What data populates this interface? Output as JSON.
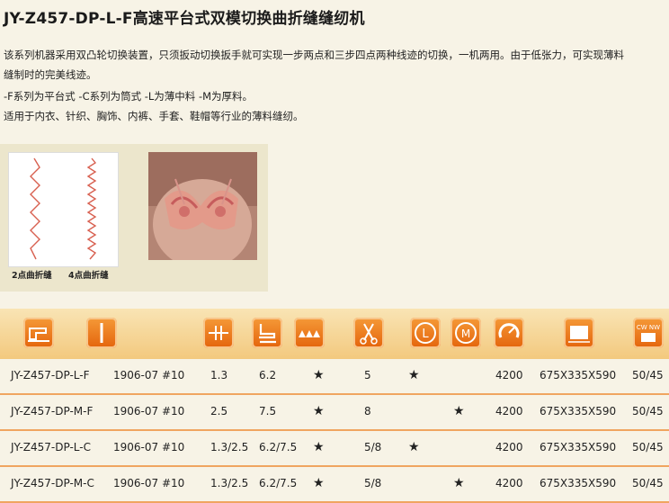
{
  "title": "JY-Z457-DP-L-F高速平台式双模切换曲折缝缝纫机",
  "description": {
    "line1": "该系列机器采用双凸轮切换装置，只须扳动切换扳手就可实现一步两点和三步四点两种线迹的切换，一机两用。由于低张力，可实现薄料",
    "line2": "缝制时的完美线迹。",
    "line3": "-F系列为平台式    -C系列为筒式   -L为薄中料    -M为厚料。",
    "line4": "适用于内衣、针织、胸饰、内裤、手套、鞋帽等行业的薄料缝纫。"
  },
  "samples": {
    "caption_2pt": "2点曲折缝",
    "caption_4pt": "4点曲折缝"
  },
  "header_icons": [
    "sewing-machine-icon",
    "needle-icon",
    "stitch-length-icon",
    "presser-foot-icon",
    "stitch-width-icon",
    "scissors-icon",
    "light-material-icon",
    "medium-heavy-material-icon",
    "speed-icon",
    "dimensions-icon",
    "weight-icon"
  ],
  "header_text": {
    "light": "L",
    "heavy": "M",
    "weight": "CW NW"
  },
  "rows": [
    {
      "model": "JY-Z457-DP-L-F",
      "needle": "1906-07 #10",
      "length": "1.3",
      "width": "6.2",
      "star": "★",
      "points": "5",
      "starL": "★",
      "starM": "",
      "speed": "4200",
      "dim": "675X335X590",
      "pack": "50/45"
    },
    {
      "model": "JY-Z457-DP-M-F",
      "needle": "1906-07 #10",
      "length": "2.5",
      "width": "7.5",
      "star": "★",
      "points": "8",
      "starL": "",
      "starM": "★",
      "speed": "4200",
      "dim": "675X335X590",
      "pack": "50/45"
    },
    {
      "model": "JY-Z457-DP-L-C",
      "needle": "1906-07 #10",
      "length": "1.3/2.5",
      "width": "6.2/7.5",
      "star": "★",
      "points": "5/8",
      "starL": "★",
      "starM": "",
      "speed": "4200",
      "dim": "675X335X590",
      "pack": "50/45"
    },
    {
      "model": "JY-Z457-DP-M-C",
      "needle": "1906-07 #10",
      "length": "1.3/2.5",
      "width": "6.2/7.5",
      "star": "★",
      "points": "5/8",
      "starL": "",
      "starM": "★",
      "speed": "4200",
      "dim": "675X335X590",
      "pack": "50/45"
    }
  ],
  "colors": {
    "accent": "#e86f14",
    "divider": "#f0a560",
    "header_bg": "#f3c97e"
  }
}
